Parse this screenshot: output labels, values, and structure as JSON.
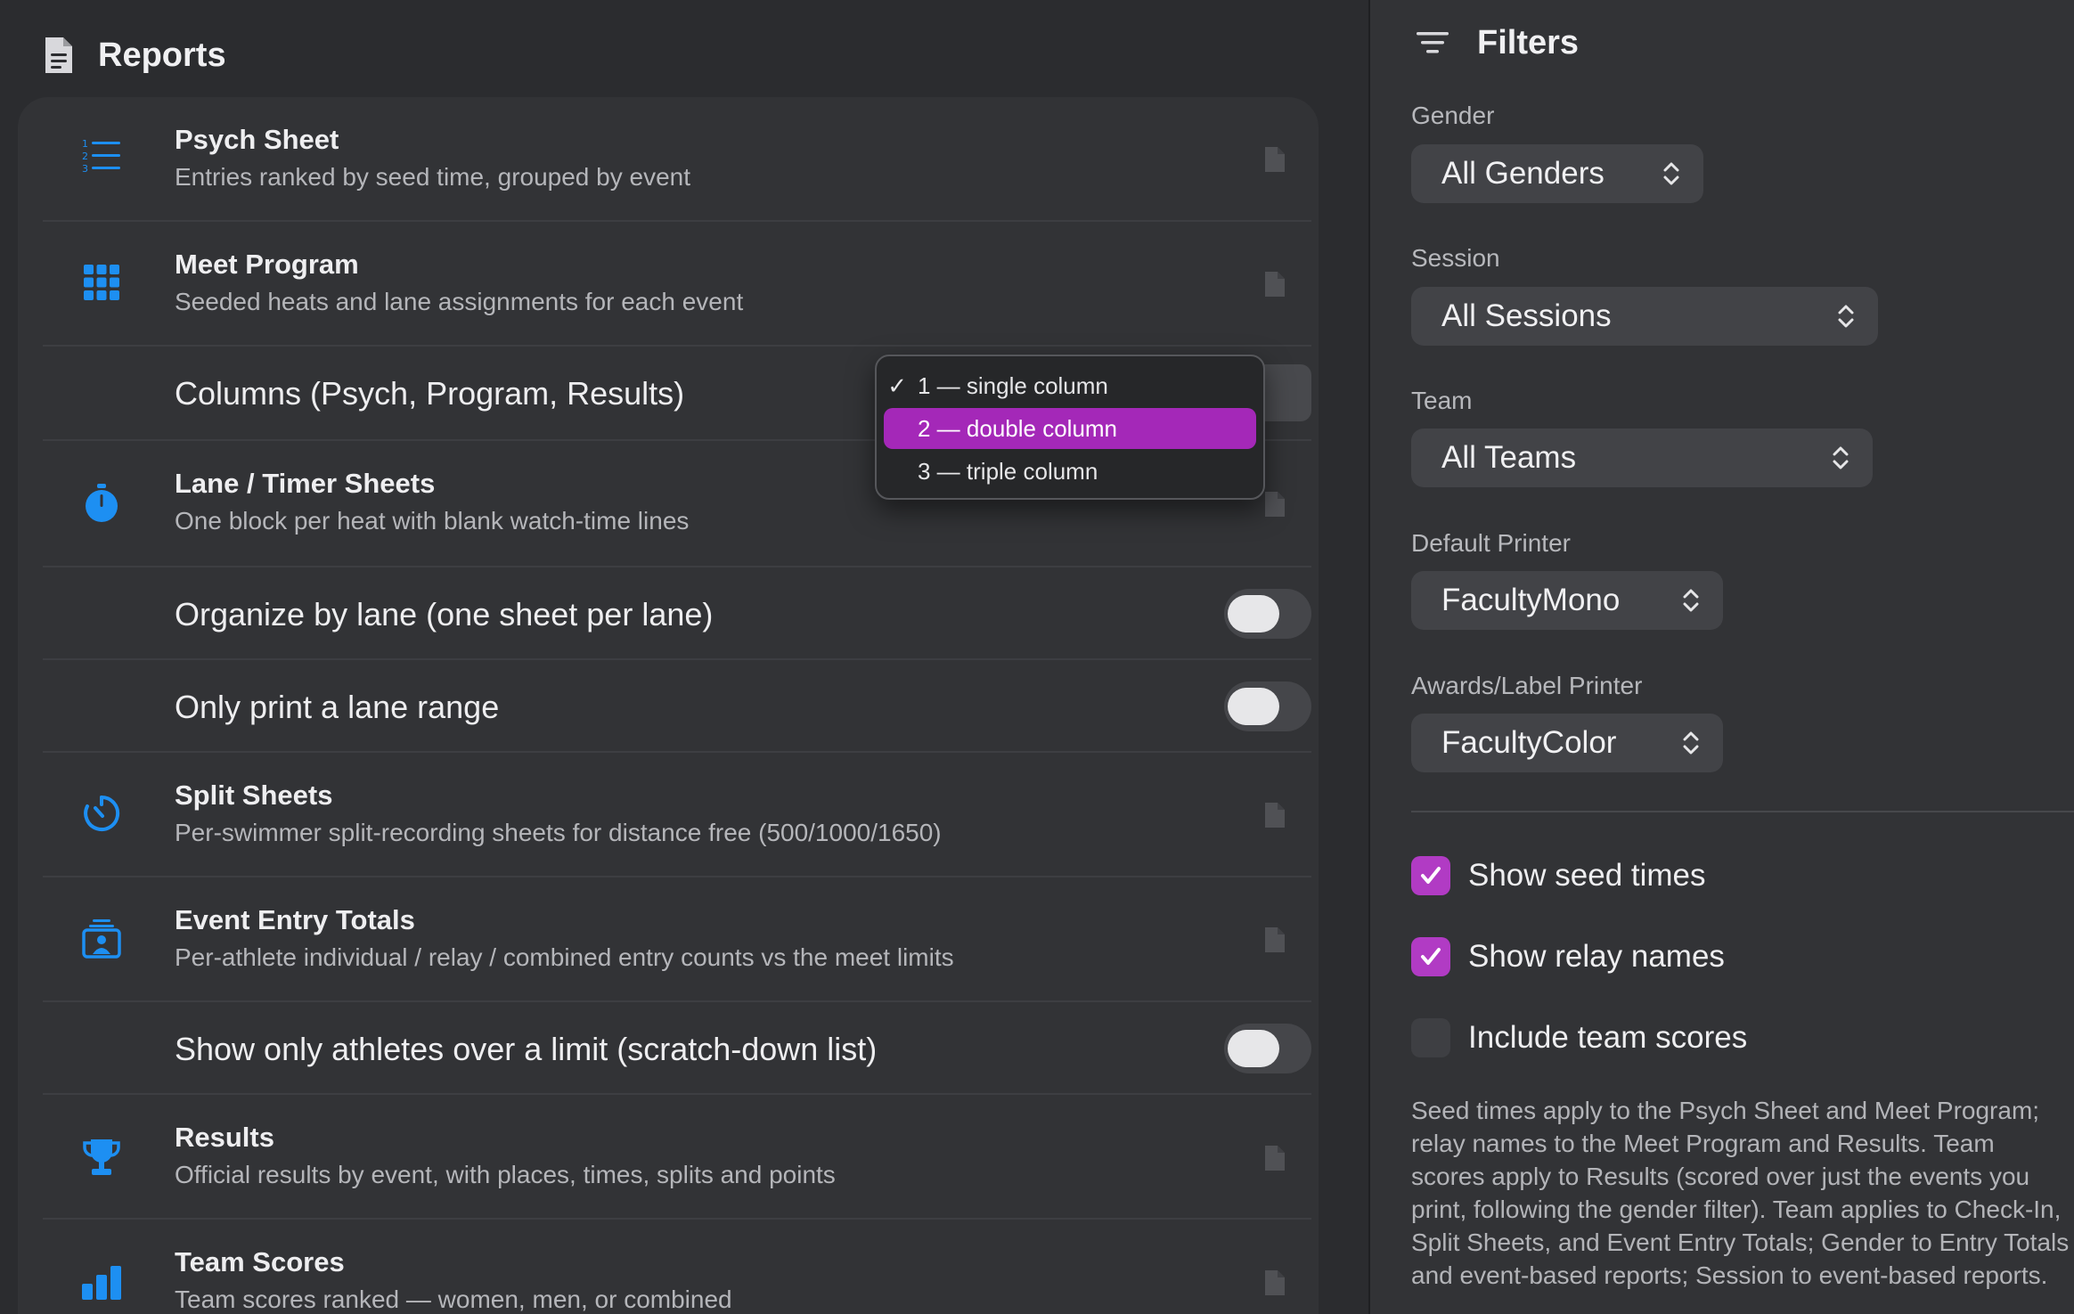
{
  "reports": {
    "title": "Reports",
    "items": {
      "psych": {
        "title": "Psych Sheet",
        "subtitle": "Entries ranked by seed time, grouped by event"
      },
      "program": {
        "title": "Meet Program",
        "subtitle": "Seeded heats and lane assignments for each event"
      },
      "columns": {
        "label": "Columns (Psych, Program, Results)"
      },
      "lane": {
        "title": "Lane / Timer Sheets",
        "subtitle": "One block per heat with blank watch-time lines"
      },
      "organize": {
        "label": "Organize by lane (one sheet per lane)",
        "on": false
      },
      "range": {
        "label": "Only print a lane range",
        "on": false
      },
      "split": {
        "title": "Split Sheets",
        "subtitle": "Per-swimmer split-recording sheets for distance free (500/1000/1650)"
      },
      "entry": {
        "title": "Event Entry Totals",
        "subtitle": "Per-athlete individual / relay / combined entry counts vs the meet limits"
      },
      "scratch": {
        "label": "Show only athletes over a limit (scratch-down list)",
        "on": false
      },
      "results": {
        "title": "Results",
        "subtitle": "Official results by event, with places, times, splits and points"
      },
      "scores": {
        "title": "Team Scores",
        "subtitle": "Team scores ranked — women, men, or combined"
      }
    }
  },
  "columns_menu": {
    "options": [
      {
        "check": "✓",
        "label": "1 — single column"
      },
      {
        "check": "",
        "label": "2 — double column"
      },
      {
        "check": "",
        "label": "3 — triple column"
      }
    ],
    "highlighted_index": 1
  },
  "filters": {
    "title": "Filters",
    "gender": {
      "label": "Gender",
      "value": "All Genders"
    },
    "session": {
      "label": "Session",
      "value": "All Sessions"
    },
    "team": {
      "label": "Team",
      "value": "All Teams"
    },
    "default_printer": {
      "label": "Default Printer",
      "value": "FacultyMono"
    },
    "awards_printer": {
      "label": "Awards/Label Printer",
      "value": "FacultyColor"
    },
    "show_seed_times": {
      "label": "Show seed times",
      "checked": true
    },
    "show_relay_names": {
      "label": "Show relay names",
      "checked": true
    },
    "include_team_scores": {
      "label": "Include team scores",
      "checked": false
    },
    "note": "Seed times apply to the Psych Sheet and Meet Program; relay names to the Meet Program and Results. Team scores apply to Results (scored over just the events you print, following the gender filter). Team applies to Check-In, Split Sheets, and Event Entry Totals; Gender to Entry Totals and event-based reports; Session to event-based reports."
  },
  "colors": {
    "accent": "#b13bc4",
    "menu_highlight": "#a428b8",
    "icon_blue": "#1d8ff2"
  }
}
